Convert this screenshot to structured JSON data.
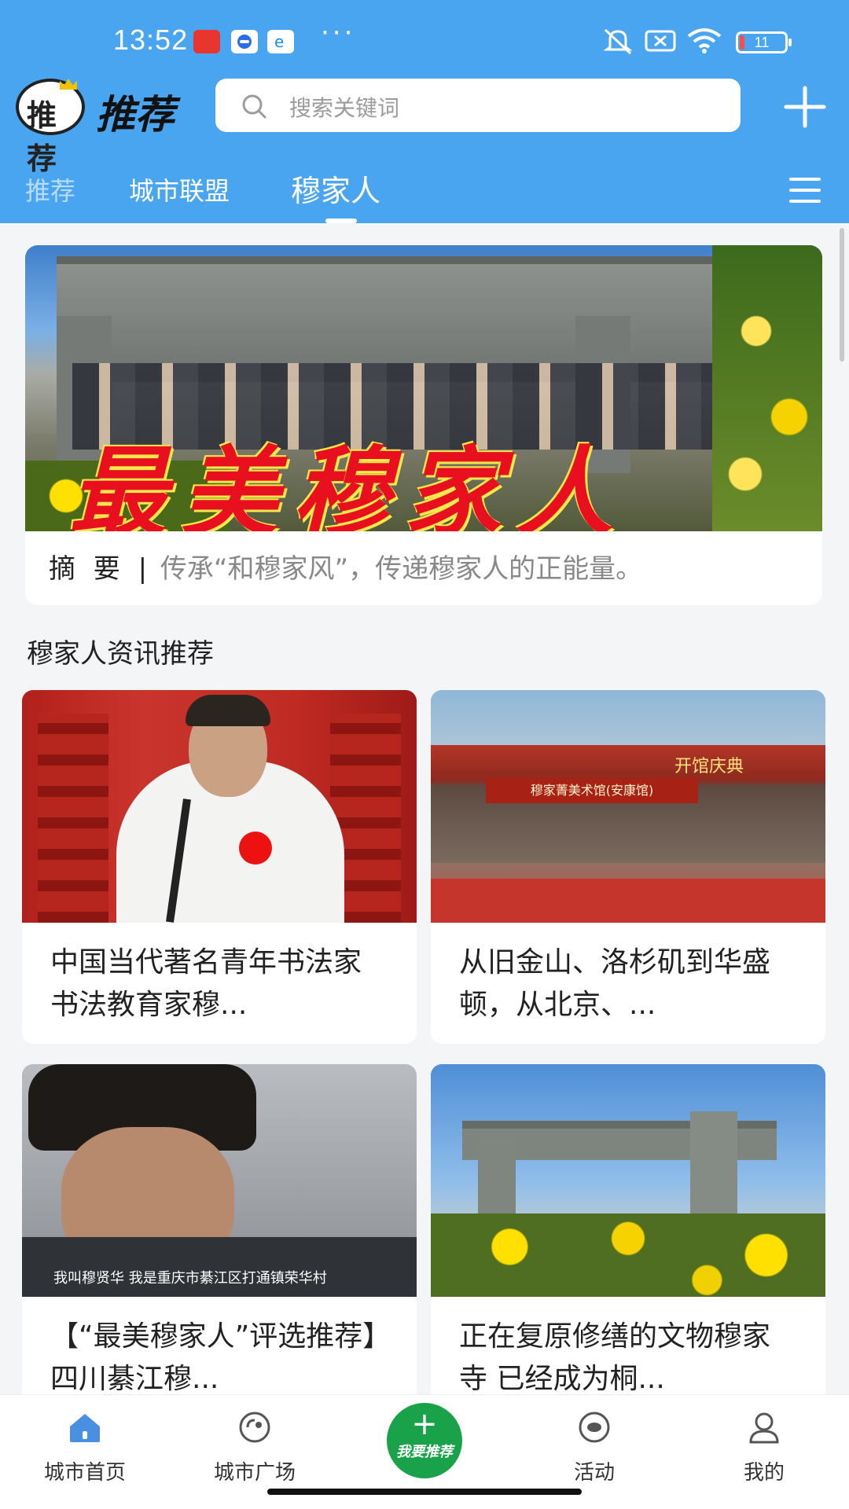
{
  "status_bar": {
    "time": "13:52",
    "dots": "···",
    "battery": "11"
  },
  "header": {
    "logo_text": "推荐",
    "logo_badge": "推荐",
    "search_placeholder": "搜索关键词",
    "plus_icon": "plus-icon"
  },
  "tabs": [
    {
      "label": "推荐"
    },
    {
      "label": "城市联盟"
    },
    {
      "label": "穆家人"
    }
  ],
  "banner": {
    "title": "最美穆家人",
    "summary_label": "摘 要 |",
    "summary_text": "传承“和穆家风”，传递穆家人的正能量。"
  },
  "section": {
    "title": "穆家人资讯推荐"
  },
  "news": [
    {
      "title": "中国当代著名青年书法家 书法教育家穆..."
    },
    {
      "title": "从旧金山、洛杉矶到华盛顿，从北京、..."
    },
    {
      "title": "【“最美穆家人”评选推荐】四川綦江穆..."
    },
    {
      "title": "正在复原修缮的文物穆家寺 已经成为桐..."
    }
  ],
  "image_text": {
    "img2_sign": "穆家菁美术馆(安康馆)",
    "img2_sign2": "开馆庆典",
    "img3_caption": "我叫穆贤华 我是重庆市綦江区打通镇荣华村"
  },
  "bottom_nav": {
    "home": "城市首页",
    "plaza": "城市广场",
    "recommend": "我要推荐",
    "activity": "活动",
    "mine": "我的"
  },
  "colors": {
    "header_blue": "#4aa5f0",
    "accent_green": "#1aa24b",
    "home_active": "#4a90e2"
  }
}
